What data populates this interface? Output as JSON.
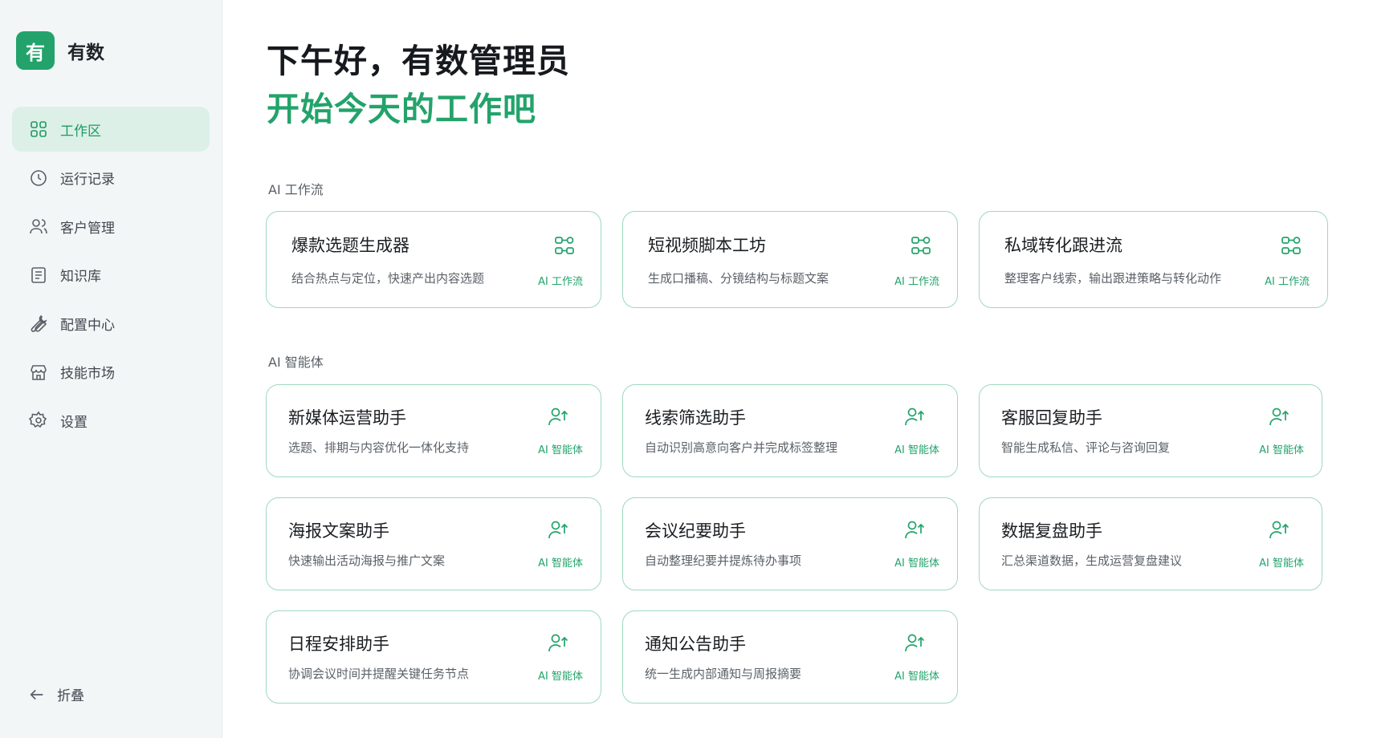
{
  "brand": {
    "logo_char": "有",
    "name": "有数"
  },
  "sidebar": {
    "items": [
      {
        "label": "工作区",
        "icon": "grid-icon",
        "active": true
      },
      {
        "label": "运行记录",
        "icon": "clock-icon"
      },
      {
        "label": "客户管理",
        "icon": "users-icon"
      },
      {
        "label": "知识库",
        "icon": "document-icon"
      },
      {
        "label": "配置中心",
        "icon": "wrench-icon"
      },
      {
        "label": "技能市场",
        "icon": "store-icon"
      },
      {
        "label": "设置",
        "icon": "gear-icon"
      }
    ],
    "collapse_label": "折叠"
  },
  "header": {
    "greeting": "下午好，有数管理员",
    "subtitle": "开始今天的工作吧"
  },
  "workflows": {
    "section_title": "AI 工作流",
    "tag": "AI 工作流",
    "items": [
      {
        "title": "爆款选题生成器",
        "desc": "结合热点与定位，快速产出内容选题"
      },
      {
        "title": "短视频脚本工坊",
        "desc": "生成口播稿、分镜结构与标题文案"
      },
      {
        "title": "私域转化跟进流",
        "desc": "整理客户线索，输出跟进策略与转化动作"
      }
    ]
  },
  "agents": {
    "section_title": "AI 智能体",
    "tag": "AI 智能体",
    "items": [
      {
        "title": "新媒体运营助手",
        "desc": "选题、排期与内容优化一体化支持"
      },
      {
        "title": "线索筛选助手",
        "desc": "自动识别高意向客户并完成标签整理"
      },
      {
        "title": "客服回复助手",
        "desc": "智能生成私信、评论与咨询回复"
      },
      {
        "title": "海报文案助手",
        "desc": "快速输出活动海报与推广文案"
      },
      {
        "title": "会议纪要助手",
        "desc": "自动整理纪要并提炼待办事项"
      },
      {
        "title": "数据复盘助手",
        "desc": "汇总渠道数据，生成运营复盘建议"
      },
      {
        "title": "日程安排助手",
        "desc": "协调会议时间并提醒关键任务节点"
      },
      {
        "title": "通知公告助手",
        "desc": "统一生成内部通知与周报摘要"
      }
    ]
  },
  "colors": {
    "accent": "#23a36b",
    "active_bg": "#dcf0e7",
    "card_border": "#9dd9bd"
  }
}
